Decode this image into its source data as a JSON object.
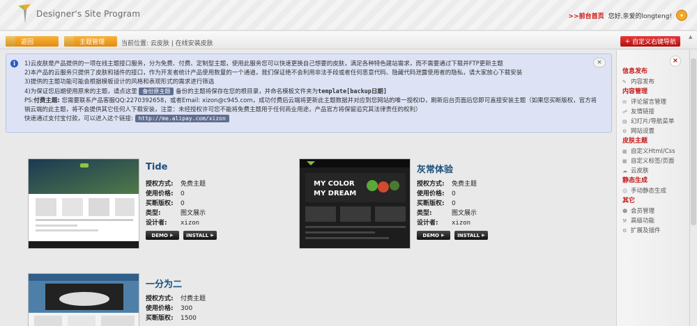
{
  "header": {
    "app_title": "Designer's Site Program",
    "home_link": ">>前台首页",
    "greeting": "您好,亲爱的longteng!",
    "user_menu_icon": "chevron-down-icon"
  },
  "toolbar": {
    "back_label": "返回",
    "theme_manage_label": "主题管理",
    "location": "当前位置:  云皮肤  |  在线安装皮肤",
    "custom_nav_label": "自定义右键导航"
  },
  "info": {
    "line1": "1)云皮肤是产品提供的一项在线主题接口服务，分为免费、付费、定制型主题，使用此服务您可以快速更换自己想要的皮肤，满足各种特色建站需求，而不需要通过下载并FTP更新主题",
    "line2": "2)本产品的云服务只提供了皮肤和插件的接口，作为开发者统计产品使用数量的一个通道，我们保证绝不会利用非法手段或者任何恶意代码、隐藏代码泄露使用者的隐私，请大家放心下载安装",
    "line3": "3)提供的主题功能可能会根据模板设计的风格和表现形式的需求进行筛选",
    "line4_prefix": "4)为保证您后期使用原来的主题，请点这里",
    "backup_chip": "备份原主题",
    "line4_suffix": "备份的主题将保存在您的根目录，并命名模板文件夹为",
    "line4_code": "template[backup日期]",
    "line5_ps": "PS:",
    "line5_bold": "付费主题:",
    "line5_text": "您需要联系产品客服QQ:2270392658，或者Email: xizon@c945.com，成功付费后云端将更新此主题数据并对应到您网站的唯一授权ID，刷新后台页面后您即可直接安装主题（如果您买断版权，官方将删",
    "line6": "销云端的此主题，将不会提供其它任何人下载安装，注意：未经授权许可您不能将免费主题用于任何商业用途，产品官方将保留追究其法律责任的权利）",
    "line7_prefix": "快速通过支付宝付款，可以进入这个链接:",
    "alipay_link": "http://me.alipay.com/xizon"
  },
  "theme_labels": {
    "license": "授权方式:",
    "price": "使用价格:",
    "buyout": "买断版权:",
    "type": "类型:",
    "designer": "设计者:",
    "demo": "DEMO",
    "install": "INSTALL"
  },
  "themes": [
    {
      "title": "Tide",
      "license": "免费主题",
      "price": "0",
      "buyout": "0",
      "type": "图文展示",
      "designer": "xizon"
    },
    {
      "title": "灰常体验",
      "license": "免费主题",
      "price": "0",
      "buyout": "0",
      "type": "图文展示",
      "designer": "xizon",
      "thumb_text": "MY COLOR\nMY DREAM"
    },
    {
      "title": "一分为二",
      "license": "付费主题",
      "price": "300",
      "buyout": "1500"
    }
  ],
  "sidebar": {
    "sections": [
      {
        "title": "信息发布",
        "items": [
          "内容发布"
        ]
      },
      {
        "title": "内容管理",
        "items": [
          "评论留言管理",
          "友情链接",
          "幻灯片/导航菜单",
          "网站设置"
        ]
      },
      {
        "title": "皮肤主题",
        "items": [
          "自定义Html/Css",
          "自定义标签/页面",
          "云皮肤"
        ]
      },
      {
        "title": "静态生成",
        "items": [
          "手动静态生成"
        ]
      },
      {
        "title": "其它",
        "items": [
          "会员管理",
          "高级功能",
          "扩展及插件"
        ]
      }
    ]
  },
  "colors": {
    "accent_orange": "#e48b10",
    "accent_red": "#c51c1c",
    "title_blue": "#1a4f7e",
    "info_bg": "#dde3f5"
  }
}
